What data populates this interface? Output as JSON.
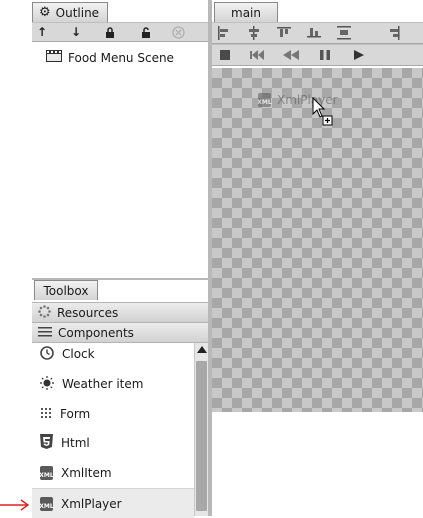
{
  "outline": {
    "tab_label": "Outline",
    "tree_item": "Food Menu Scene"
  },
  "main_panel": {
    "tab_label": "main"
  },
  "canvas": {
    "drag_ghost_label": "XmlPlayer"
  },
  "toolbox": {
    "tab_label": "Toolbox",
    "sections": {
      "resources": "Resources",
      "components": "Components"
    },
    "items": [
      {
        "label": "Clock",
        "icon": "clock-icon"
      },
      {
        "label": "Weather item",
        "icon": "weather-icon"
      },
      {
        "label": "Form",
        "icon": "form-icon"
      },
      {
        "label": "Html",
        "icon": "html5-icon"
      },
      {
        "label": "XmlItem",
        "icon": "xml-icon"
      },
      {
        "label": "XmlPlayer",
        "icon": "xml-icon"
      }
    ],
    "icon_text": "XML"
  },
  "annotation": {
    "arrow_color": "#e02020"
  }
}
